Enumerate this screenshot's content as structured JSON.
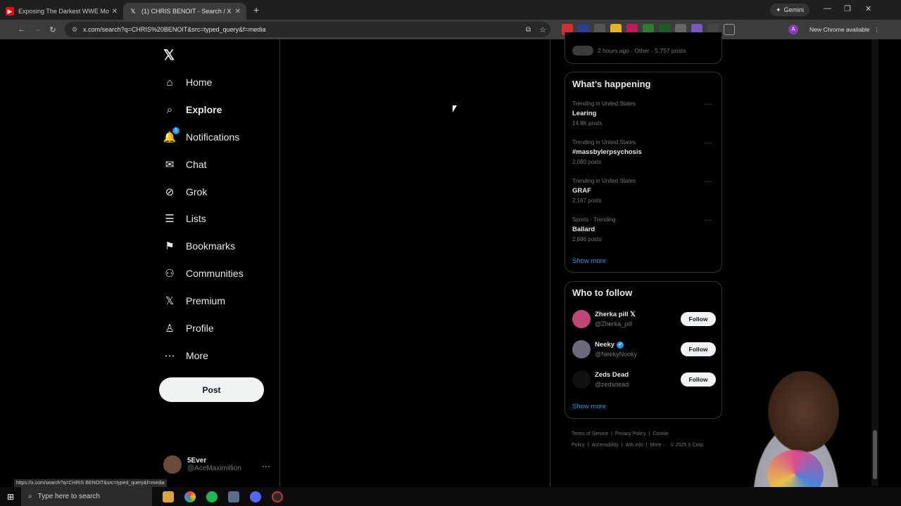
{
  "browser": {
    "tabs": [
      {
        "title": "Exposing The Darkest WWE Mo",
        "favicon": "youtube-icon"
      },
      {
        "title": "(1) CHRIS BENOIT - Search / X",
        "favicon": "x-icon"
      }
    ],
    "gemini_label": "Gemini",
    "url": "x.com/search?q=CHRIS%20BENOIT&src=typed_query&f=media",
    "update_label": "New Chrome available",
    "profile_initial": "A",
    "status_url": "https://x.com/search?q=CHRIS BENOIT&src=typed_query&f=media"
  },
  "sidebar": {
    "logo": "𝕏",
    "items": [
      {
        "label": "Home",
        "icon": "home-icon",
        "glyph": "⌂"
      },
      {
        "label": "Explore",
        "icon": "search-icon",
        "glyph": "⌕"
      },
      {
        "label": "Notifications",
        "icon": "bell-icon",
        "glyph": "🔔",
        "badge": "1"
      },
      {
        "label": "Chat",
        "icon": "mail-icon",
        "glyph": "✉"
      },
      {
        "label": "Grok",
        "icon": "grok-icon",
        "glyph": "⊘"
      },
      {
        "label": "Lists",
        "icon": "lists-icon",
        "glyph": "☰"
      },
      {
        "label": "Bookmarks",
        "icon": "bookmark-icon",
        "glyph": "⚑"
      },
      {
        "label": "Communities",
        "icon": "communities-icon",
        "glyph": "⚇"
      },
      {
        "label": "Premium",
        "icon": "x-premium-icon",
        "glyph": "𝕏"
      },
      {
        "label": "Profile",
        "icon": "profile-icon",
        "glyph": "♙"
      },
      {
        "label": "More",
        "icon": "more-circle-icon",
        "glyph": "⋯"
      }
    ],
    "post_label": "Post",
    "account": {
      "name": "5Ever",
      "handle": "@AceMaximillion"
    }
  },
  "right": {
    "top_meta": "2 hours ago · Other · 5,757 posts",
    "happening": {
      "title": "What’s happening",
      "trends": [
        {
          "context": "Trending in United States",
          "title": "Learing",
          "count": "14.9K posts"
        },
        {
          "context": "Trending in United States",
          "title": "#massbylerpsychosis",
          "count": "2,080 posts"
        },
        {
          "context": "Trending in United States",
          "title": "GRAF",
          "count": "2,167 posts"
        },
        {
          "context": "Sports · Trending",
          "title": "Ballard",
          "count": "2,696 posts"
        }
      ],
      "show_more": "Show more"
    },
    "follow": {
      "title": "Who to follow",
      "accounts": [
        {
          "name": "Zherka pill 𝕏",
          "handle": "@Zherka_pill",
          "color": "#c0467a",
          "verified": false
        },
        {
          "name": "Neeky",
          "handle": "@NeekyNooky",
          "color": "#6a6a7a",
          "verified": true
        },
        {
          "name": "Zeds Dead",
          "handle": "@zedsdead",
          "color": "#111111",
          "verified": false
        }
      ],
      "button_label": "Follow",
      "show_more": "Show more"
    },
    "footer": [
      "Terms of Service",
      "|",
      "Privacy Policy",
      "|",
      "Cookie Policy",
      "|",
      "Accessibility",
      "|",
      "Ads info",
      "|",
      "More ···",
      "© 2025 X Corp."
    ]
  },
  "taskbar": {
    "search_placeholder": "Type here to search"
  }
}
